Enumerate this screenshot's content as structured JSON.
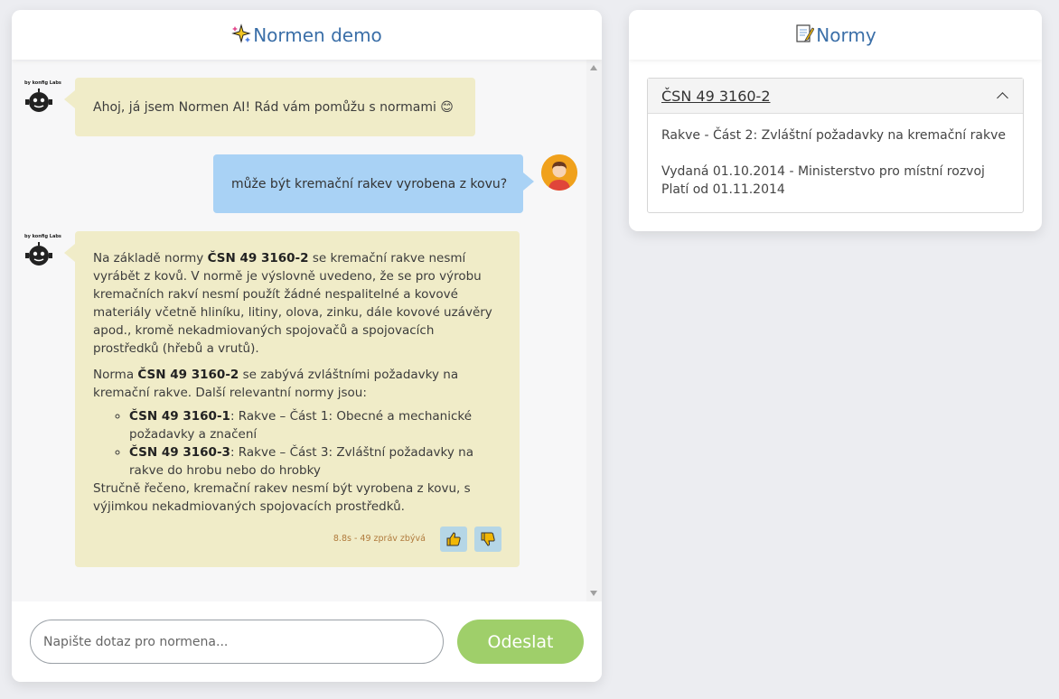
{
  "chat": {
    "title": "Normen demo",
    "title_icon": "sparkles-icon",
    "bot_logo_text": "by konfig Labs",
    "messages": [
      {
        "role": "bot",
        "text": "Ahoj, já jsem Normen AI! Rád vám pomůžu s normami 😊"
      },
      {
        "role": "user",
        "text": "může být kremační rakev vyrobena z kovu?"
      },
      {
        "role": "bot",
        "p1_a": "Na základě normy ",
        "p1_b": "ČSN 49 3160-2",
        "p1_c": " se kremační rakve nesmí vyrábět z kovů. V normě je výslovně uvedeno, že se pro výrobu kremačních rakví nesmí použít žádné nespalitelné a kovové materiály včetně hliníku, litiny, olova, zinku, dále kovové uzávěry apod., kromě nekadmiovaných spojovačů a spojovacích prostředků (hřebů a vrutů).",
        "p2_a": "Norma ",
        "p2_b": "ČSN 49 3160-2",
        "p2_c": " se zabývá zvláštními požadavky na kremační rakve. Další relevantní normy jsou:",
        "list": [
          {
            "code": "ČSN 49 3160-1",
            "text": ": Rakve – Část 1: Obecné a mechanické požadavky a značení"
          },
          {
            "code": "ČSN 49 3160-3",
            "text": ": Rakve – Část 3: Zvláštní požadavky na rakve do hrobu nebo do hrobky"
          }
        ],
        "p3": "Stručně řečeno, kremační rakev nesmí být vyrobena z kovu, s výjimkou nekadmiovaných spojovacích prostředků.",
        "meta": "8.8s - 49 zpráv zbývá"
      }
    ],
    "input_placeholder": "Napište dotaz pro normena...",
    "input_value": "",
    "send_label": "Odeslat"
  },
  "norms": {
    "title": "Normy",
    "title_icon": "memo-icon",
    "items": [
      {
        "code": "ČSN 49 3160-2",
        "description": "Rakve - Část 2: Zvláštní požadavky na kremační rakve",
        "issued": "Vydaná 01.10.2014 - Ministerstvo pro místní rozvoj",
        "valid_from": "Platí od 01.11.2014"
      }
    ]
  },
  "colors": {
    "header_text": "#3b6fa8",
    "bot_bubble": "#f0ecc8",
    "user_bubble": "#a9d2f5",
    "send_button": "#9fcf6a",
    "meta_text": "#b07a3c"
  }
}
